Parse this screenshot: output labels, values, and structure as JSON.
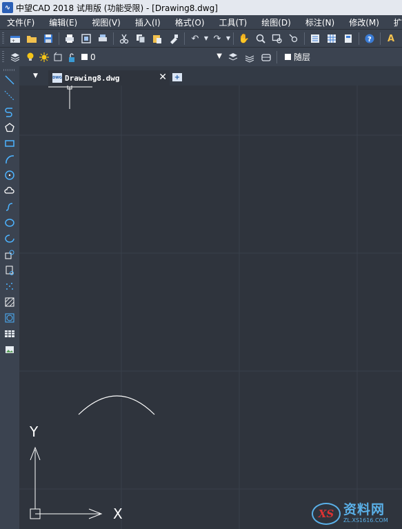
{
  "titlebar": {
    "app_icon": "zwcad-app-icon",
    "title": "中望CAD 2018 试用版 (功能受限) - [Drawing8.dwg]"
  },
  "menubar": {
    "items": [
      "文件(F)",
      "编辑(E)",
      "视图(V)",
      "插入(I)",
      "格式(O)",
      "工具(T)",
      "绘图(D)",
      "标注(N)",
      "修改(M)",
      "扩展"
    ]
  },
  "toolbar1": {
    "icons": [
      "new-file-icon",
      "open-folder-icon",
      "save-icon",
      "print-icon",
      "print-preview-icon",
      "plot-icon",
      "cut-icon",
      "copy-icon",
      "paste-icon",
      "match-properties-icon",
      "undo-icon",
      "redo-icon",
      "pan-hand-icon",
      "zoom-realtime-icon",
      "zoom-window-icon",
      "zoom-previous-icon",
      "properties-icon",
      "design-center-icon",
      "tool-palettes-icon",
      "help-icon",
      "text-style-icon"
    ]
  },
  "toolbar2": {
    "layer_icons": [
      "layer-manager-icon",
      "layer-on-bulb-icon",
      "layer-sun-icon",
      "layer-freeze-icon",
      "layer-unlock-icon"
    ],
    "current_layer": "0",
    "layer_tool_icons": [
      "make-current-icon",
      "layer-previous-icon",
      "layer-states-icon"
    ],
    "color_value": "随层"
  },
  "left_toolbar": {
    "icons": [
      "line-icon",
      "construction-line-icon",
      "polyline-icon",
      "polygon-icon",
      "rectangle-icon",
      "arc-icon",
      "circle-icon",
      "revision-cloud-icon",
      "spline-icon",
      "ellipse-icon",
      "ellipse-arc-icon",
      "insert-block-icon",
      "make-block-icon",
      "point-icon",
      "hatch-icon",
      "region-icon",
      "table-icon",
      "image-icon"
    ]
  },
  "tabs": {
    "active_label": "Drawing8.dwg",
    "dwg_icon_text": "DWG"
  },
  "ucs": {
    "x_label": "X",
    "y_label": "Y"
  },
  "watermark": {
    "logo_text": "XS",
    "name": "资料网",
    "url": "ZL.XS1616.COM"
  },
  "colors": {
    "canvas_bg": "#2f343d",
    "toolbar_bg": "#3b4350",
    "grid_line": "#394049",
    "titlebar_bg": "#e4e8ef",
    "accent_blue": "#5ab0e8"
  }
}
